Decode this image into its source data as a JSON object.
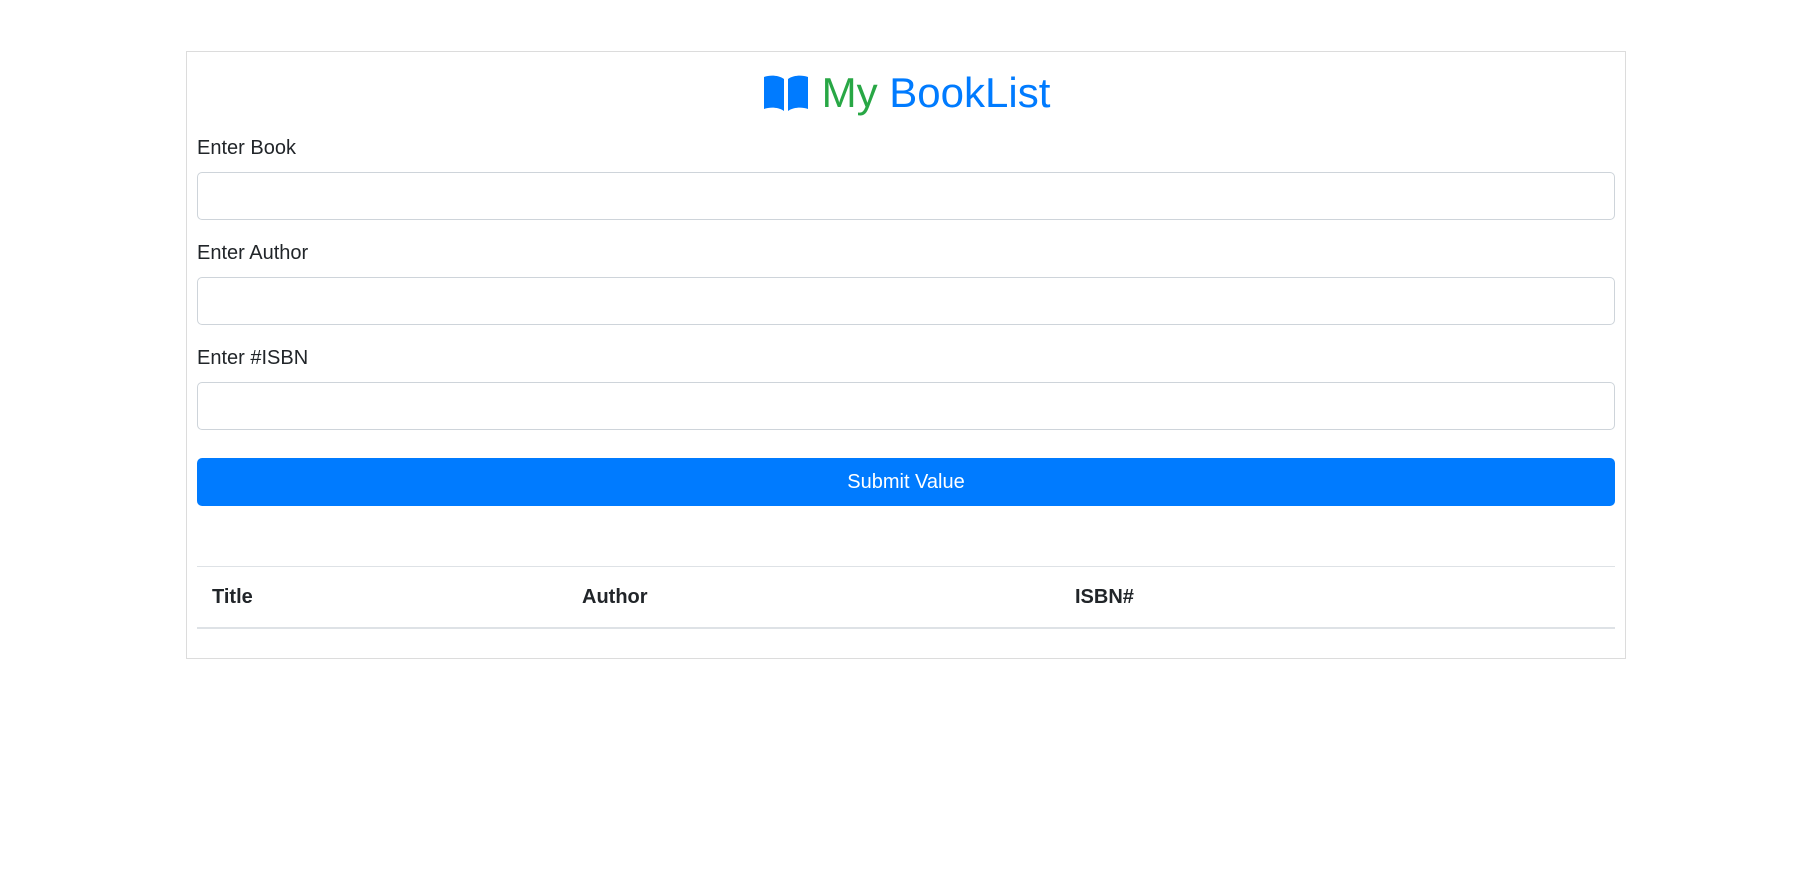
{
  "brand": {
    "icon": "open-book-icon",
    "title_part1": "My",
    "title_part2": "BookList",
    "colors": {
      "green": "#28a745",
      "blue": "#007bff"
    }
  },
  "form": {
    "book_label": "Enter Book",
    "book_value": "",
    "author_label": "Enter Author",
    "author_value": "",
    "isbn_label": "Enter #ISBN",
    "isbn_value": "",
    "submit_label": "Submit Value",
    "submit_color": "#007bff"
  },
  "table": {
    "headers": [
      "Title",
      "Author",
      "ISBN#"
    ],
    "rows": []
  }
}
